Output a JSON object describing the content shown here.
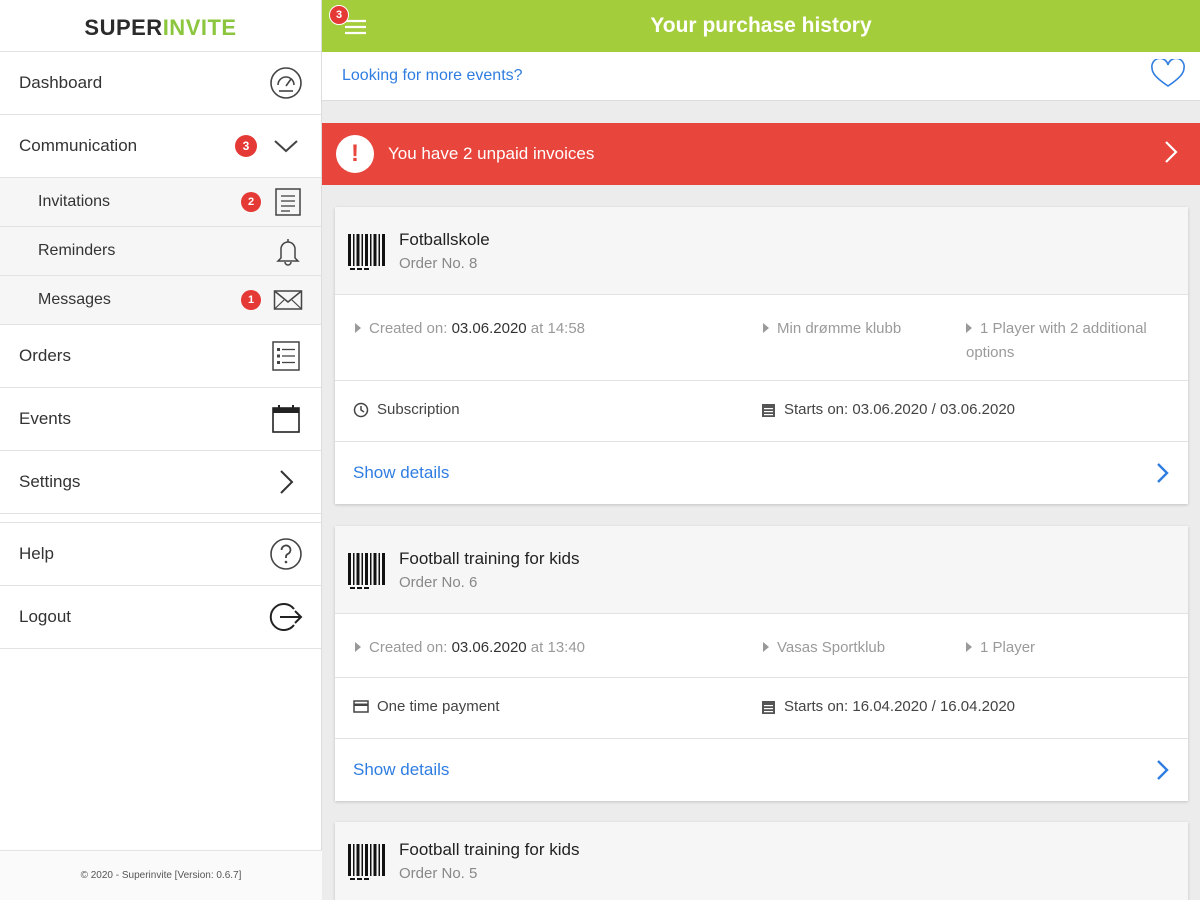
{
  "logo": {
    "part1": "SUPER",
    "part2": "INVITE"
  },
  "sidebar": {
    "items": [
      {
        "label": "Dashboard",
        "icon": "dashboard-icon"
      },
      {
        "label": "Communication",
        "badge": "3",
        "icon": "chevron-down-icon"
      },
      {
        "label": "Invitations",
        "badge": "2",
        "icon": "document-icon"
      },
      {
        "label": "Reminders",
        "icon": "bell-icon"
      },
      {
        "label": "Messages",
        "badge": "1",
        "icon": "envelope-icon"
      },
      {
        "label": "Orders",
        "icon": "list-icon"
      },
      {
        "label": "Events",
        "icon": "calendar-icon"
      },
      {
        "label": "Settings",
        "icon": "chevron-right-icon"
      },
      {
        "label": "Help",
        "icon": "help-icon"
      },
      {
        "label": "Logout",
        "icon": "logout-icon"
      }
    ],
    "footer": "© 2020 - Superinvite [Version: 0.6.7]"
  },
  "header": {
    "title": "Your purchase history",
    "menu_badge": "3"
  },
  "events_link": "Looking for more events?",
  "alert": {
    "text": "You have 2 unpaid invoices",
    "icon": "!"
  },
  "orders": [
    {
      "title": "Fotballskole",
      "order_no": "Order No. 8",
      "created_prefix": "Created on: ",
      "created_date": "03.06.2020",
      "created_at": " at 14:58",
      "club": "Min drømme klubb",
      "players": "1 Player with 2 additional options",
      "payment": "Subscription",
      "payment_icon": "clock-icon",
      "starts": "Starts on: 03.06.2020 / 03.06.2020",
      "details": "Show details"
    },
    {
      "title": "Football training for kids",
      "order_no": "Order No. 6",
      "created_prefix": "Created on: ",
      "created_date": "03.06.2020",
      "created_at": " at 13:40",
      "club": "Vasas Sportklub",
      "players": "1 Player",
      "payment": "One time payment",
      "payment_icon": "card-icon",
      "starts": "Starts on: 16.04.2020 / 16.04.2020",
      "details": "Show details"
    },
    {
      "title": "Football training for kids",
      "order_no": "Order No. 5"
    }
  ],
  "colors": {
    "brand_green": "#a3cd3a",
    "alert_red": "#e8453c",
    "link_blue": "#2f7de1",
    "badge_red": "#e53935"
  }
}
